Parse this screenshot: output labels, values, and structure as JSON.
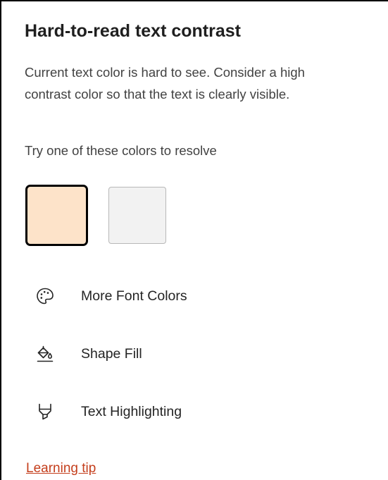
{
  "panel": {
    "title": "Hard-to-read text contrast",
    "description_lines": [
      "Current text color is hard to see. Consider a high",
      "contrast color so that the text is clearly visible."
    ],
    "try_label": "Try one of these colors to resolve"
  },
  "swatches": [
    {
      "color": "#fde3c9",
      "selected": true
    },
    {
      "color": "#f2f2f2",
      "selected": false
    }
  ],
  "actions": [
    {
      "label": "More Font Colors",
      "icon": "palette-icon"
    },
    {
      "label": "Shape Fill",
      "icon": "paint-bucket-icon"
    },
    {
      "label": "Text Highlighting",
      "icon": "highlighter-icon"
    }
  ],
  "link": {
    "label": "Learning tip",
    "color": "#c43e1c"
  }
}
